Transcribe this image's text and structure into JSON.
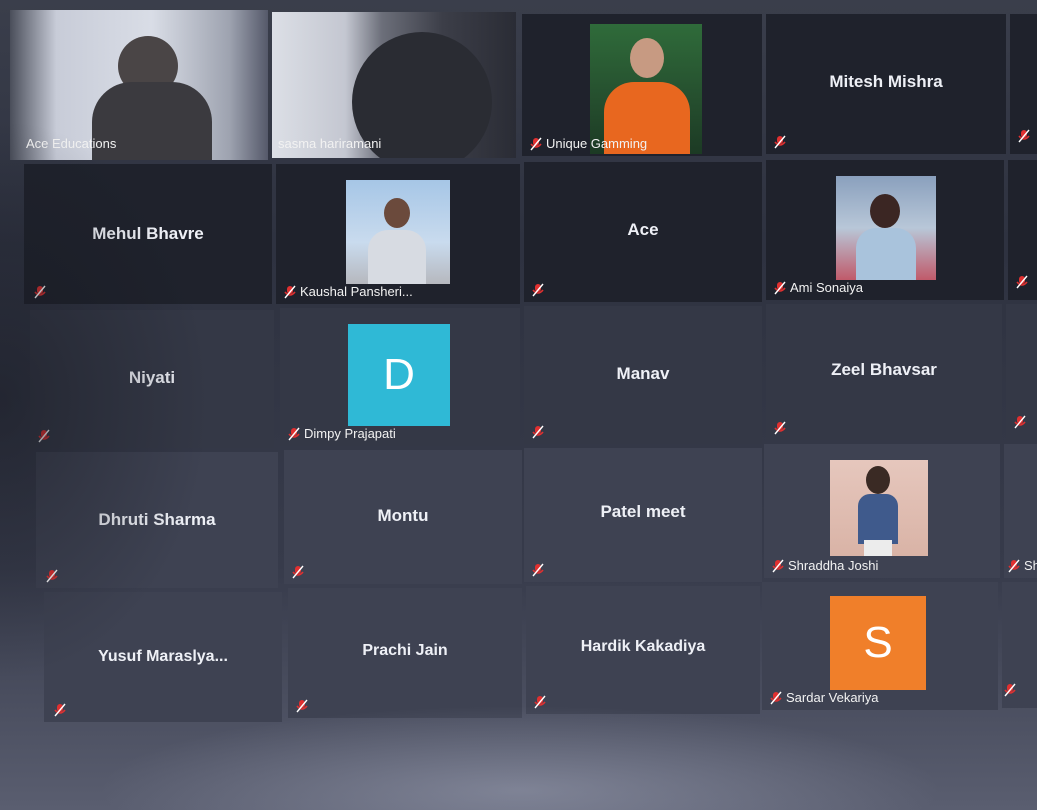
{
  "participants": [
    {
      "name": "Ace Educations",
      "label": "Ace Educations"
    },
    {
      "name": "sasma hariramani",
      "label": "sasma hariramani"
    },
    {
      "name": "Unique Gamming",
      "label": "Unique Gamming"
    },
    {
      "name": "Mitesh Mishra",
      "label": ""
    },
    {
      "name": "Mehul Bhavre",
      "label": ""
    },
    {
      "name": "Kaushal Pansheri...",
      "label": "Kaushal Pansheri..."
    },
    {
      "name": "Ace",
      "label": ""
    },
    {
      "name": "Ami Sonaiya",
      "label": "Ami Sonaiya"
    },
    {
      "name": "Niyati",
      "label": ""
    },
    {
      "name": "Dimpy Prajapati",
      "label": "Dimpy Prajapati",
      "avatar": "D"
    },
    {
      "name": "Manav",
      "label": ""
    },
    {
      "name": "Zeel Bhavsar",
      "label": ""
    },
    {
      "name": "Dhruti Sharma",
      "label": ""
    },
    {
      "name": "Montu",
      "label": ""
    },
    {
      "name": "Patel meet",
      "label": ""
    },
    {
      "name": "Shraddha Joshi",
      "label": "Shraddha Joshi"
    },
    {
      "name": "Yusuf  Maraslya...",
      "label": ""
    },
    {
      "name": "Prachi Jain",
      "label": ""
    },
    {
      "name": "Hardik Kakadiya",
      "label": ""
    },
    {
      "name": "Sardar Vekariya",
      "label": "Sardar Vekariya",
      "avatar": "S"
    }
  ],
  "edge_labels": {
    "row4": "Sh"
  },
  "colors": {
    "active_border": "#d8d24a",
    "muted_icon": "#e03030",
    "avatar_d": "#2fb9d6",
    "avatar_s": "#f07f2a"
  },
  "icons": {
    "muted": "mic-muted-icon"
  }
}
